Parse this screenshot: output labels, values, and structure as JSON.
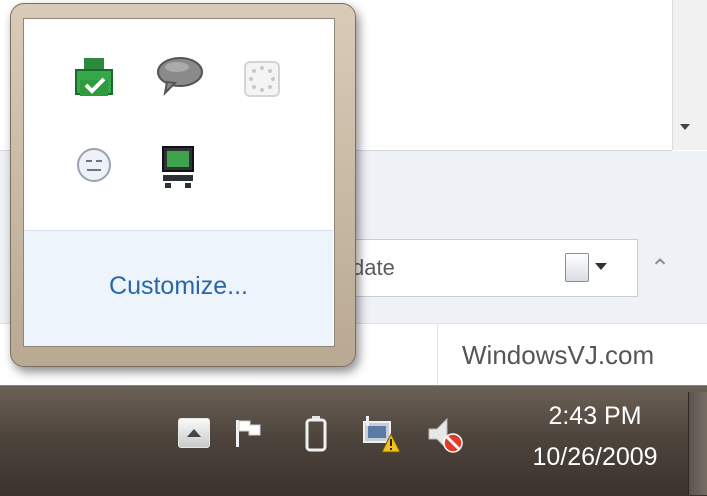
{
  "search": {
    "text": "date"
  },
  "watermark": {
    "text": "WindowsVJ.com"
  },
  "overflow_popup": {
    "customize_label": "Customize...",
    "icons": [
      "printer-status-icon",
      "chat-bubble-icon",
      "loading-icon",
      "messenger-status-icon",
      "network-monitor-icon"
    ]
  },
  "taskbar": {
    "tray_icons": [
      "show-hidden-icons-button",
      "action-center-flag-icon",
      "battery-icon",
      "network-warning-icon",
      "volume-muted-icon"
    ],
    "clock": {
      "time": "2:43 PM",
      "date": "10/26/2009"
    }
  },
  "colors": {
    "taskbar": "#4e453d",
    "popup_frame": "#c9b9a3",
    "link": "#2a66a8",
    "network_ok": "#2e9b3c"
  }
}
